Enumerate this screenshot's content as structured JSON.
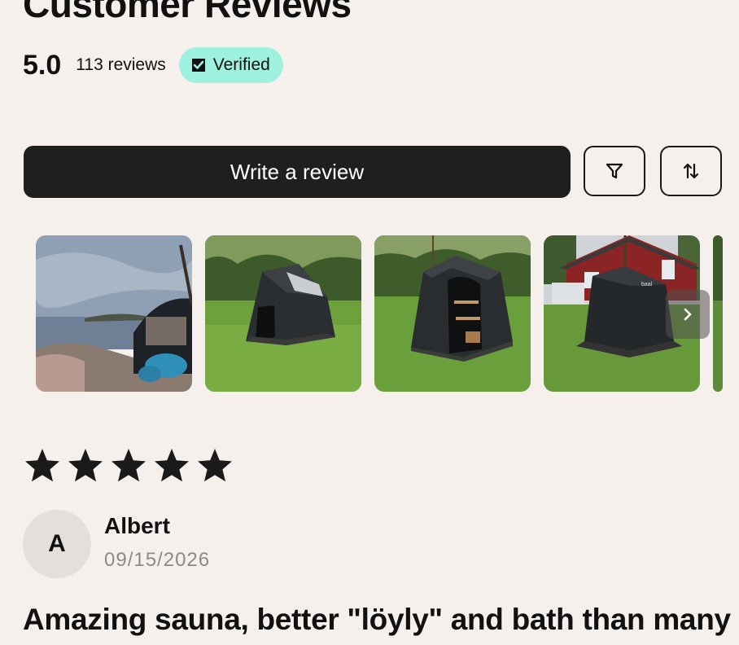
{
  "header": {
    "title": "Customer Reviews",
    "rating": "5.0",
    "review_count": "113 reviews",
    "verified_label": "Verified"
  },
  "actions": {
    "write_review_label": "Write a review",
    "filter_icon": "filter-icon",
    "sort_icon": "sort-icon"
  },
  "gallery": {
    "photos": [
      {
        "subject": "sauna tent by the sea"
      },
      {
        "subject": "black sauna tent on lawn"
      },
      {
        "subject": "open sauna tent with benches"
      },
      {
        "subject": "sauna tent in front of red house"
      }
    ],
    "next_icon": "chevron-right-icon"
  },
  "review": {
    "stars": 5,
    "avatar_initial": "A",
    "author": "Albert",
    "date": "09/15/2026",
    "title": "Amazing sauna, better \"löyly\" and bath than many"
  },
  "colors": {
    "background": "#f5f0ec",
    "button_dark": "#1f1f1f",
    "verified_badge": "#9ef0df",
    "star": "#1a1a1a",
    "date_text": "#8a8a8a"
  }
}
